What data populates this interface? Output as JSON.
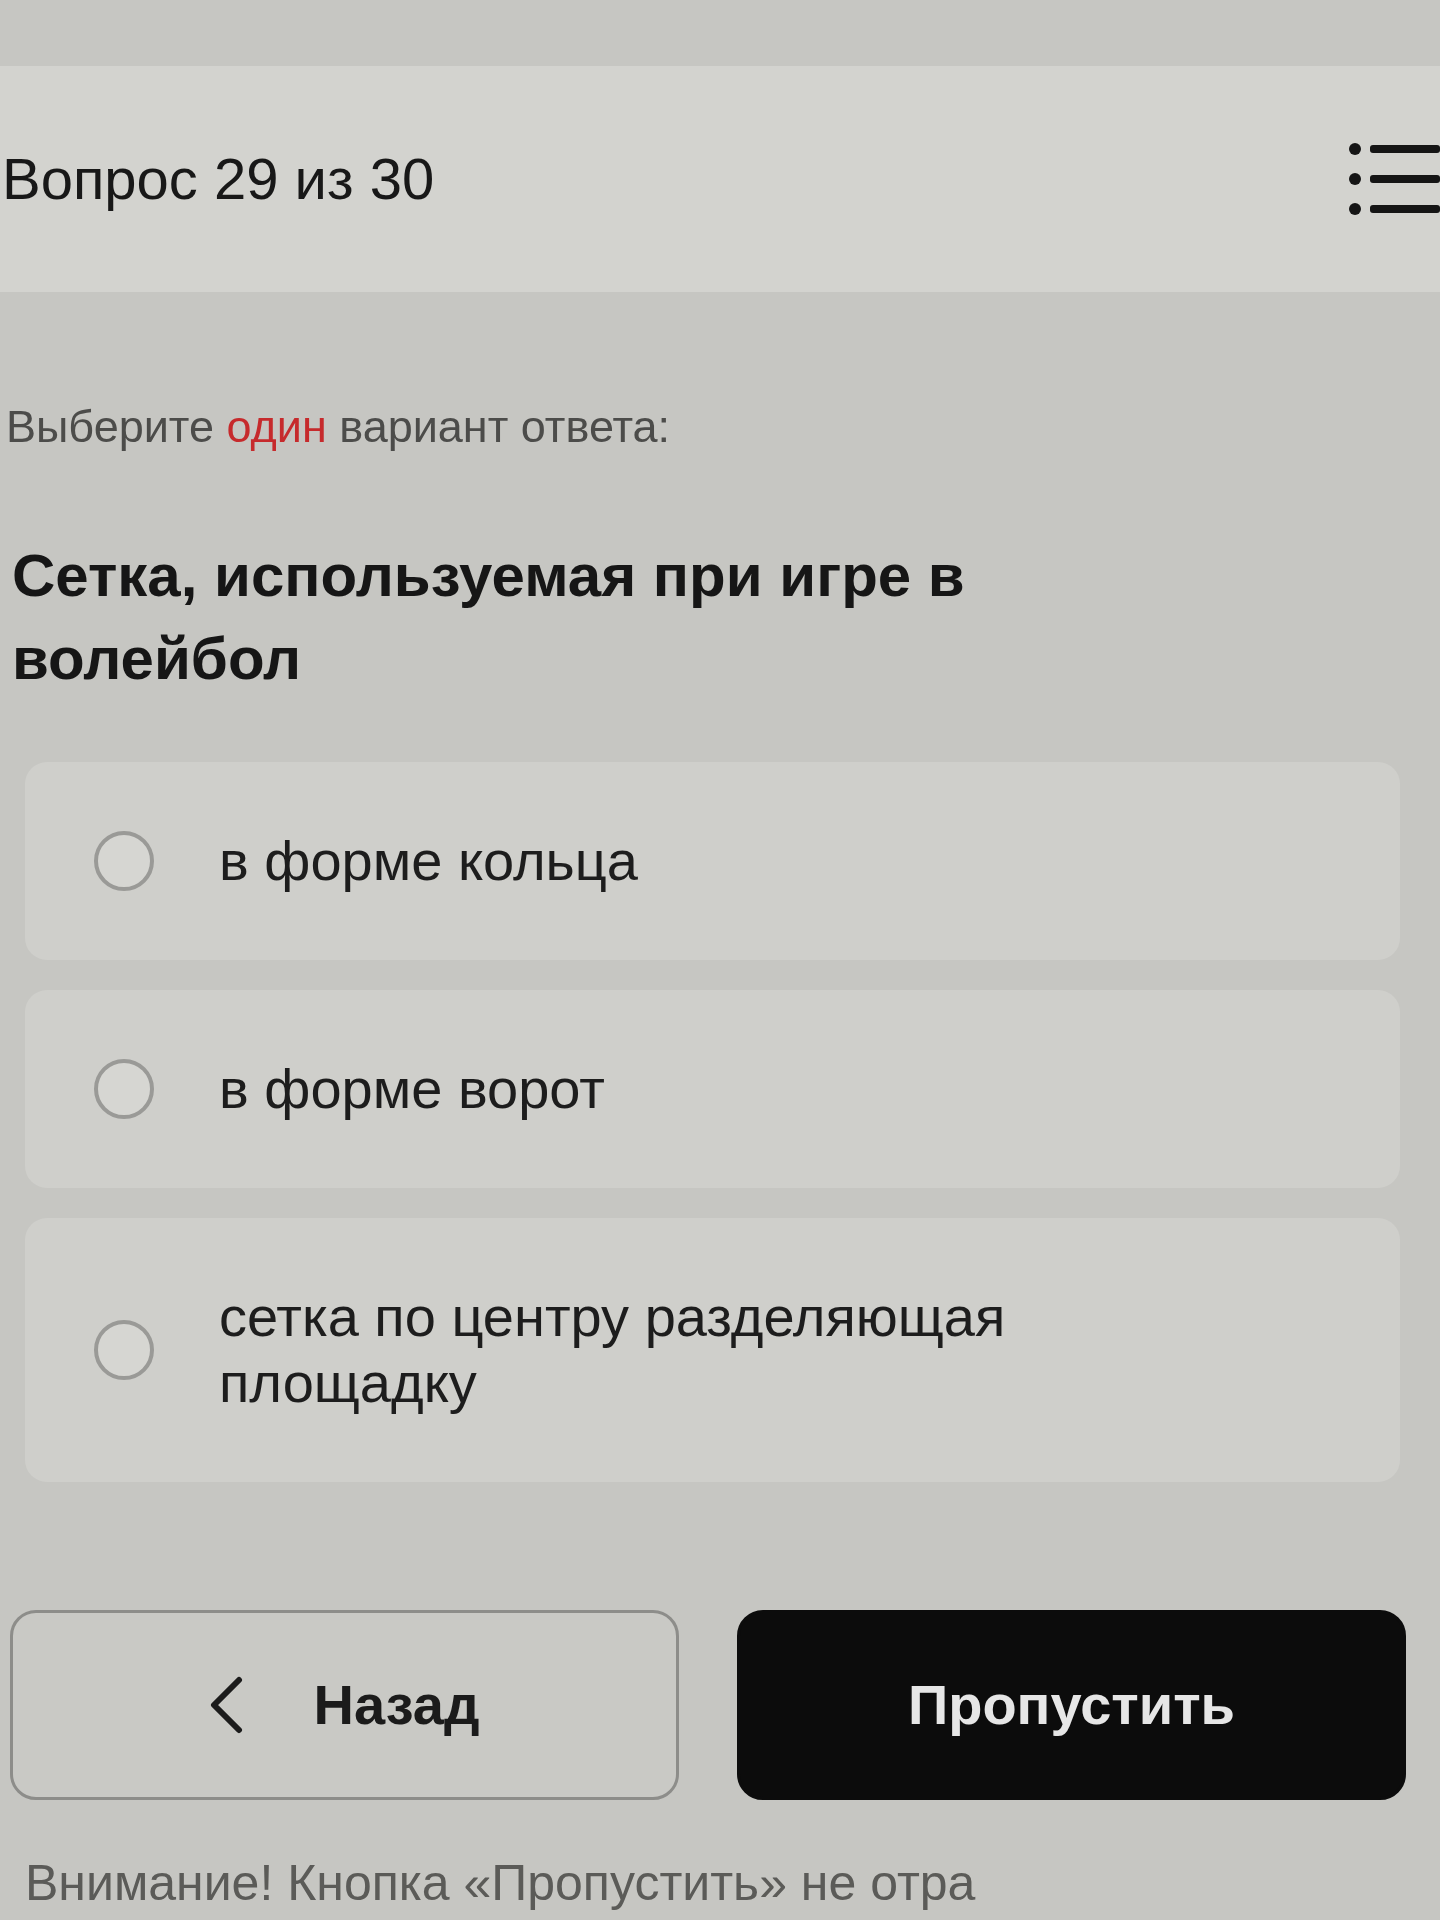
{
  "header": {
    "title": "Вопрос 29 из 30"
  },
  "instruction": [
    {
      "text": "Выберите",
      "highlighted": false
    },
    {
      "text": "один",
      "highlighted": true
    },
    {
      "text": "вариант ответа:",
      "highlighted": false
    }
  ],
  "question": "Сетка, используемая при игре в волейбол",
  "options": [
    {
      "label": "в форме кольца",
      "selected": false
    },
    {
      "label": "в форме ворот",
      "selected": false
    },
    {
      "label": "сетка по центру разделяющая площадку",
      "selected": false
    }
  ],
  "buttons": [
    {
      "kind": "back",
      "label": "Назад"
    },
    {
      "kind": "skip",
      "label": "Пропустить"
    }
  ],
  "notice": "Внимание! Кнопка «Пропустить» не отра"
}
